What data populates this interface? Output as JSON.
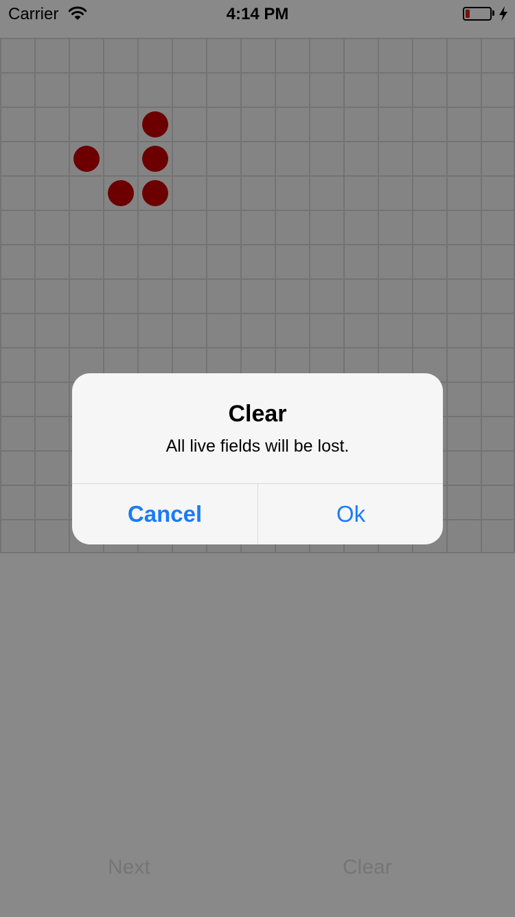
{
  "status_bar": {
    "carrier": "Carrier",
    "time": "4:14 PM",
    "wifi_icon": "wifi-icon",
    "battery_icon": "battery-low-icon",
    "charging_icon": "lightning-bolt-icon",
    "battery_level_fraction": 0.18,
    "battery_color": "#e0201e"
  },
  "board": {
    "columns": 15,
    "rows": 15,
    "cell_color": "#f4f4f4",
    "line_color": "#d5d5d5",
    "live_color": "#c80000",
    "live_cells": [
      {
        "row": 2,
        "col": 4
      },
      {
        "row": 3,
        "col": 2
      },
      {
        "row": 3,
        "col": 4
      },
      {
        "row": 4,
        "col": 3
      },
      {
        "row": 4,
        "col": 4
      }
    ]
  },
  "toolbar": {
    "next_label": "Next",
    "clear_label": "Clear"
  },
  "alert": {
    "title": "Clear",
    "message": "All live fields will be lost.",
    "cancel_label": "Cancel",
    "ok_label": "Ok",
    "button_color": "#1a7cf5"
  }
}
